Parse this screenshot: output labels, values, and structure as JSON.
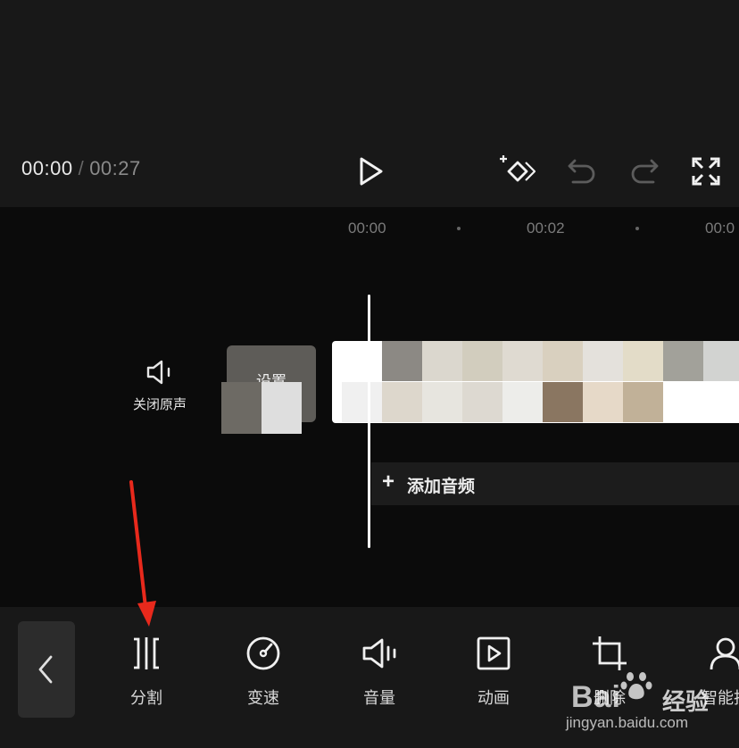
{
  "player": {
    "current_time": "00:00",
    "separator": "/",
    "total_time": "00:27"
  },
  "controls": {
    "icons": [
      "play-icon",
      "keyframe-icon",
      "undo-icon",
      "redo-icon",
      "fullscreen-icon"
    ]
  },
  "ruler": {
    "labels": [
      "00:00",
      "00:02",
      "00:0"
    ]
  },
  "track": {
    "mute_label": "关闭原声",
    "cover_label": "设置"
  },
  "audio": {
    "add_label": "添加音频"
  },
  "toolbar": {
    "back_icon": "chevron-left-icon",
    "tools": [
      {
        "label": "分割",
        "icon": "split-icon"
      },
      {
        "label": "变速",
        "icon": "speed-icon"
      },
      {
        "label": "音量",
        "icon": "volume-icon"
      },
      {
        "label": "动画",
        "icon": "animation-icon"
      },
      {
        "label": "删除",
        "icon": "crop-icon"
      },
      {
        "label": "智能抠",
        "icon": "smart-cutout-icon"
      }
    ]
  },
  "watermark": {
    "brand": "Bai",
    "text": "经验",
    "url": "jingyan.baidu.com"
  },
  "colors": {
    "background": "#0b0b0b",
    "panel": "#181818",
    "annotation_arrow": "#e8291c",
    "mosaic_top": [
      "#8c8984",
      "#dbd7ce",
      "#d2cdbe",
      "#dfdad1",
      "#d9d0bf",
      "#e4e1dc",
      "#e3dcc8",
      "#a2a19a",
      "#d2d3d1"
    ],
    "mosaic_bottom": [
      "#f0f0f0",
      "#ddd7cc",
      "#e7e5df",
      "#ddd9d1",
      "#ededea",
      "#8a7661",
      "#e6d9c8",
      "#c1b198",
      "#ffffff",
      "#ffffff"
    ]
  }
}
